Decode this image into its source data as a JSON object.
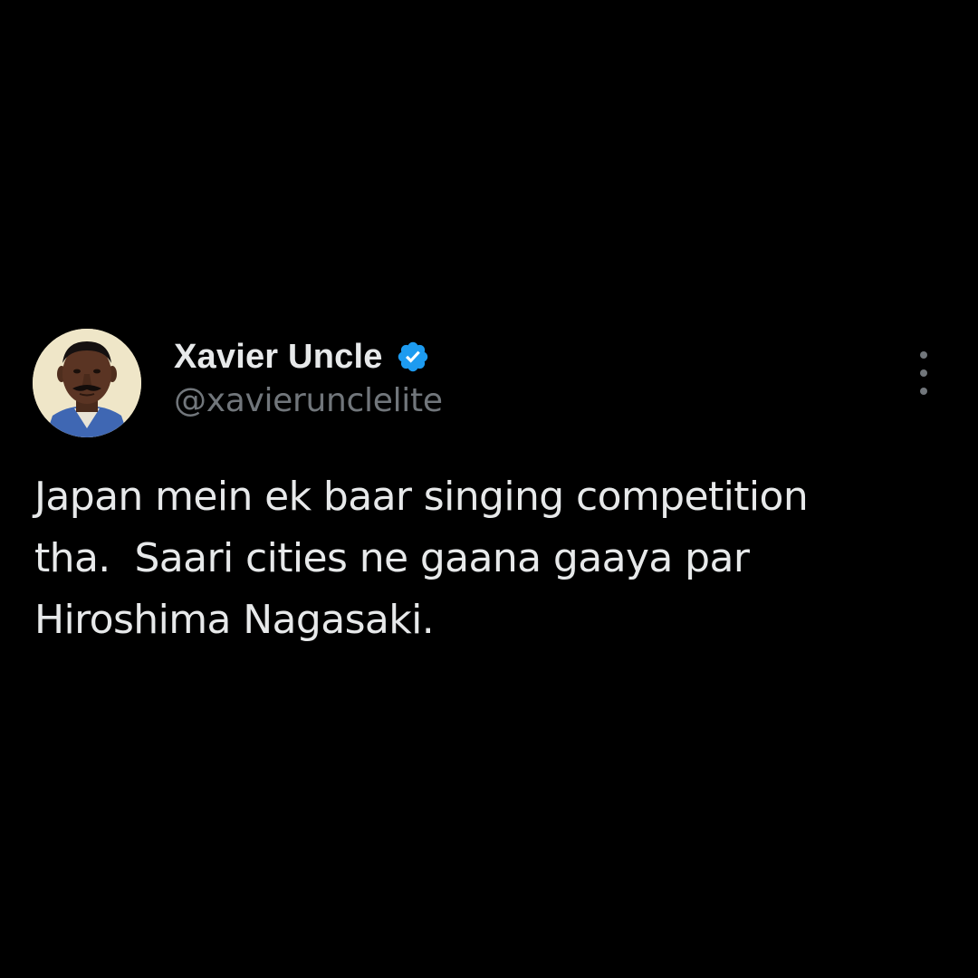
{
  "colors": {
    "background": "#000000",
    "primary_text": "#e7e9ea",
    "secondary_text": "#71767b",
    "verified_badge": "#1d9bf0"
  },
  "author": {
    "display_name": "Xavier Uncle",
    "handle": "@xavierunclelite",
    "verified": true,
    "verified_icon": "verified-badge-icon"
  },
  "menu": {
    "icon": "more-options-icon"
  },
  "tweet": {
    "lines": [
      "Japan mein ek baar singing competition",
      "tha.  Saari cities ne gaana gaaya par",
      "Hiroshima Nagasaki."
    ]
  }
}
